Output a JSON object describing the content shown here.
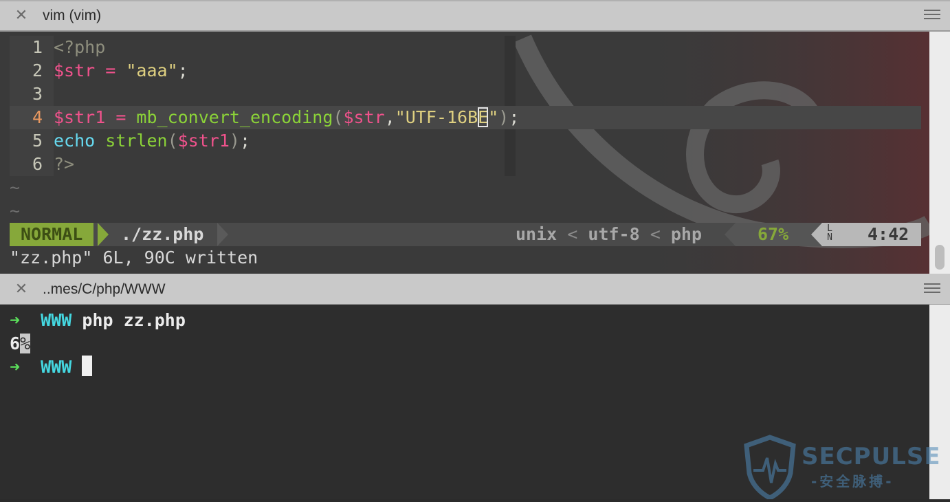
{
  "vim_tab": {
    "title": "vim (vim)",
    "close_icon": "close-icon",
    "menu_icon": "hamburger-icon"
  },
  "editor": {
    "lines": [
      {
        "num": "1"
      },
      {
        "num": "2"
      },
      {
        "num": "3"
      },
      {
        "num": "4"
      },
      {
        "num": "5"
      },
      {
        "num": "6"
      }
    ],
    "tokens": {
      "l1_open": "<?php",
      "l2_var": "$str",
      "l2_eq": " = ",
      "l2_str": "\"aaa\"",
      "l2_semi": ";",
      "l4_var": "$str1",
      "l4_eq": " = ",
      "l4_fn": "mb_convert_encoding",
      "l4_lp": "(",
      "l4_arg": "$str",
      "l4_comma": ",",
      "l4_str_a": "\"UTF-16B",
      "l4_str_cursor": "E",
      "l4_str_b": "\"",
      "l4_rp": ")",
      "l4_semi": ";",
      "l5_echo": "echo",
      "l5_sp": " ",
      "l5_fn": "strlen",
      "l5_lp": "(",
      "l5_arg": "$str1",
      "l5_rp": ")",
      "l5_semi": ";",
      "l6_close": "?>"
    },
    "tilde": "~"
  },
  "statusline": {
    "mode": "NORMAL",
    "file": "./zz.php",
    "fileformat": "unix",
    "encoding": "utf-8",
    "filetype": "php",
    "percent": "67%",
    "ln_icon": "LN",
    "position": "4:42",
    "sep": "<"
  },
  "cmdline": "\"zz.php\" 6L, 90C written",
  "term_tab": {
    "title": "..mes/C/php/WWW",
    "close_icon": "close-icon",
    "menu_icon": "hamburger-icon"
  },
  "terminal": {
    "arrow": "➜",
    "dir": "WWW",
    "command": "php zz.php",
    "output_value": "6",
    "output_marker": "%"
  },
  "watermark": {
    "text": "SECPULSE",
    "sub": "-安全脉搏-"
  },
  "colors": {
    "mode_bg": "#86a83a",
    "prompt_arrow": "#5be05b",
    "prompt_dir": "#45d7e0",
    "keyword": "#66d9ef",
    "variable": "#f0528c",
    "function": "#8bd238",
    "string": "#dfd080"
  }
}
